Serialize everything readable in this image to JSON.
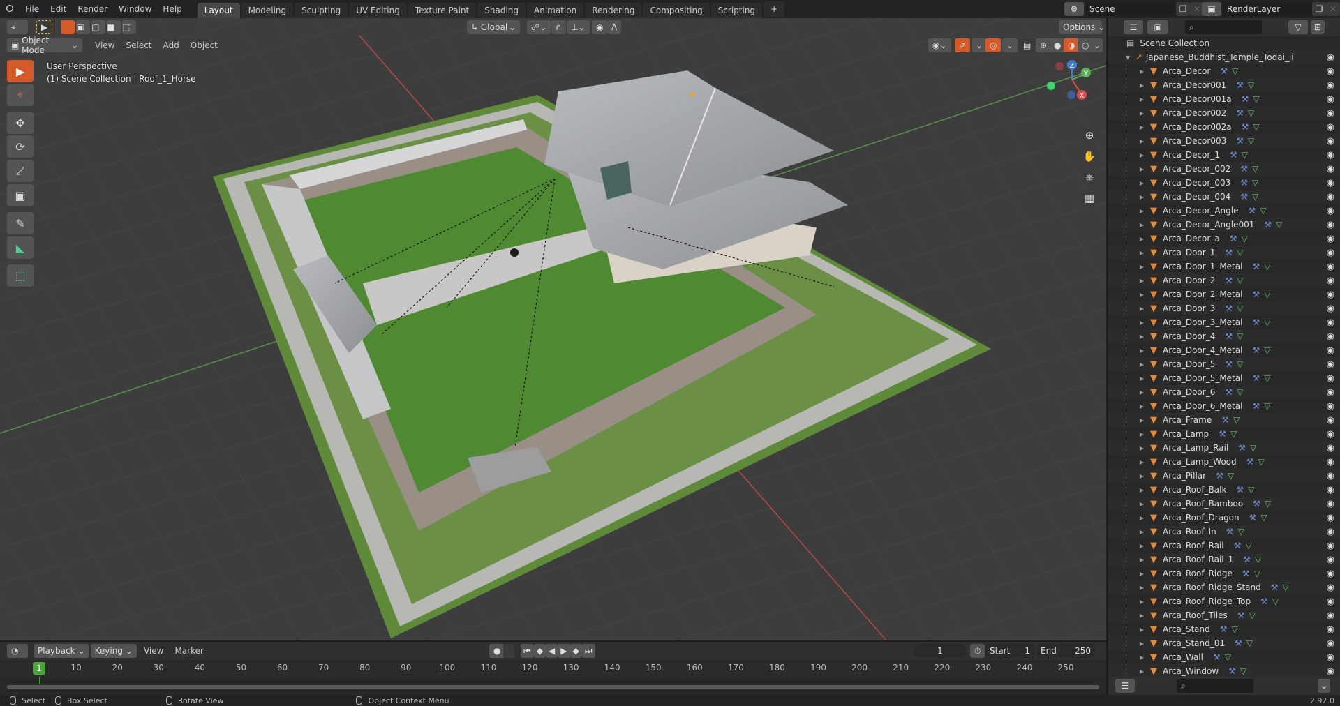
{
  "app": {
    "version": "2.92.0"
  },
  "topbar": {
    "menus": [
      "File",
      "Edit",
      "Render",
      "Window",
      "Help"
    ],
    "workspaces": [
      "Layout",
      "Modeling",
      "Sculpting",
      "UV Editing",
      "Texture Paint",
      "Shading",
      "Animation",
      "Rendering",
      "Compositing",
      "Scripting"
    ],
    "active_workspace": "Layout",
    "add_workspace": "+",
    "scene_name": "Scene",
    "view_layer": "RenderLayer"
  },
  "viewport": {
    "mode": "Object Mode",
    "menus": [
      "View",
      "Select",
      "Add",
      "Object"
    ],
    "orientation": "Global",
    "options_label": "Options",
    "overlay_text": {
      "view_name": "User Perspective",
      "context": "(1) Scene Collection | Roof_1_Horse"
    },
    "gizmo": {
      "x": "X",
      "y": "Y",
      "z": "Z"
    },
    "tools": [
      "select-box",
      "cursor",
      "move",
      "rotate",
      "scale",
      "transform",
      "annotate",
      "measure",
      "add-cube"
    ],
    "active_tool": "select-box",
    "colors": {
      "accent": "#d45a2a",
      "background": "#3d3d3d",
      "x_axis": "#d94a4a",
      "y_axis": "#6fae5a",
      "z_axis": "#3f7fd6"
    }
  },
  "outliner": {
    "search_placeholder": "",
    "root": "Scene Collection",
    "collection": "Japanese_Buddhist_Temple_Todai_ji",
    "objects": [
      "Arca_Decor",
      "Arca_Decor001",
      "Arca_Decor001a",
      "Arca_Decor002",
      "Arca_Decor002a",
      "Arca_Decor003",
      "Arca_Decor_1",
      "Arca_Decor_002",
      "Arca_Decor_003",
      "Arca_Decor_004",
      "Arca_Decor_Angle",
      "Arca_Decor_Angle001",
      "Arca_Decor_a",
      "Arca_Door_1",
      "Arca_Door_1_Metal",
      "Arca_Door_2",
      "Arca_Door_2_Metal",
      "Arca_Door_3",
      "Arca_Door_3_Metal",
      "Arca_Door_4",
      "Arca_Door_4_Metal",
      "Arca_Door_5",
      "Arca_Door_5_Metal",
      "Arca_Door_6",
      "Arca_Door_6_Metal",
      "Arca_Frame",
      "Arca_Lamp",
      "Arca_Lamp_Rail",
      "Arca_Lamp_Wood",
      "Arca_Pillar",
      "Arca_Roof_Balk",
      "Arca_Roof_Bamboo",
      "Arca_Roof_Dragon",
      "Arca_Roof_In",
      "Arca_Roof_Rail",
      "Arca_Roof_Rail_1",
      "Arca_Roof_Ridge",
      "Arca_Roof_Ridge_Stand",
      "Arca_Roof_Ridge_Top",
      "Arca_Roof_Tiles",
      "Arca_Stand",
      "Arca_Stand_01",
      "Arca_Wall",
      "Arca_Window"
    ]
  },
  "timeline": {
    "menus": [
      "Playback",
      "Keying",
      "View",
      "Marker"
    ],
    "current_frame": "1",
    "start_label": "Start",
    "start": "1",
    "end_label": "End",
    "end": "250",
    "ticks": [
      "10",
      "20",
      "30",
      "40",
      "50",
      "60",
      "70",
      "80",
      "90",
      "100",
      "110",
      "120",
      "130",
      "140",
      "150",
      "160",
      "170",
      "180",
      "190",
      "200",
      "210",
      "220",
      "230",
      "240",
      "250"
    ],
    "playhead_label": "1"
  },
  "statusbar": {
    "items": [
      "Select",
      "Box Select",
      "Rotate View",
      "Object Context Menu"
    ],
    "version": "2.92.0"
  }
}
